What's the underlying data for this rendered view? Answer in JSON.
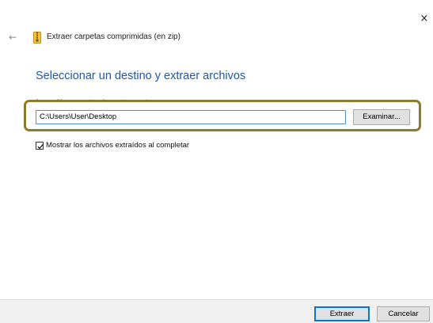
{
  "window": {
    "title": "Extraer carpetas comprimidas (en zip)",
    "close_glyph": "×",
    "back_glyph": "←"
  },
  "main": {
    "heading": "Seleccionar un destino y extraer archivos",
    "path_label": "Los archivos se extraerán a esta carpeta:",
    "path_value": "C:\\Users\\User\\Desktop",
    "browse_label": "Examinar...",
    "show_files_label": "Mostrar los archivos extraídos al completar",
    "show_files_checked": true
  },
  "footer": {
    "extract_label": "Extraer",
    "cancel_label": "Cancelar"
  },
  "icons": {
    "close": "close-icon",
    "back": "back-arrow-icon",
    "zip": "zip-folder-icon",
    "check": "checkmark-icon"
  },
  "colors": {
    "heading": "#1f58a8",
    "highlight_border": "#8d7a2d",
    "input_focus": "#4f8fd2",
    "default_button": "#0078d7"
  }
}
